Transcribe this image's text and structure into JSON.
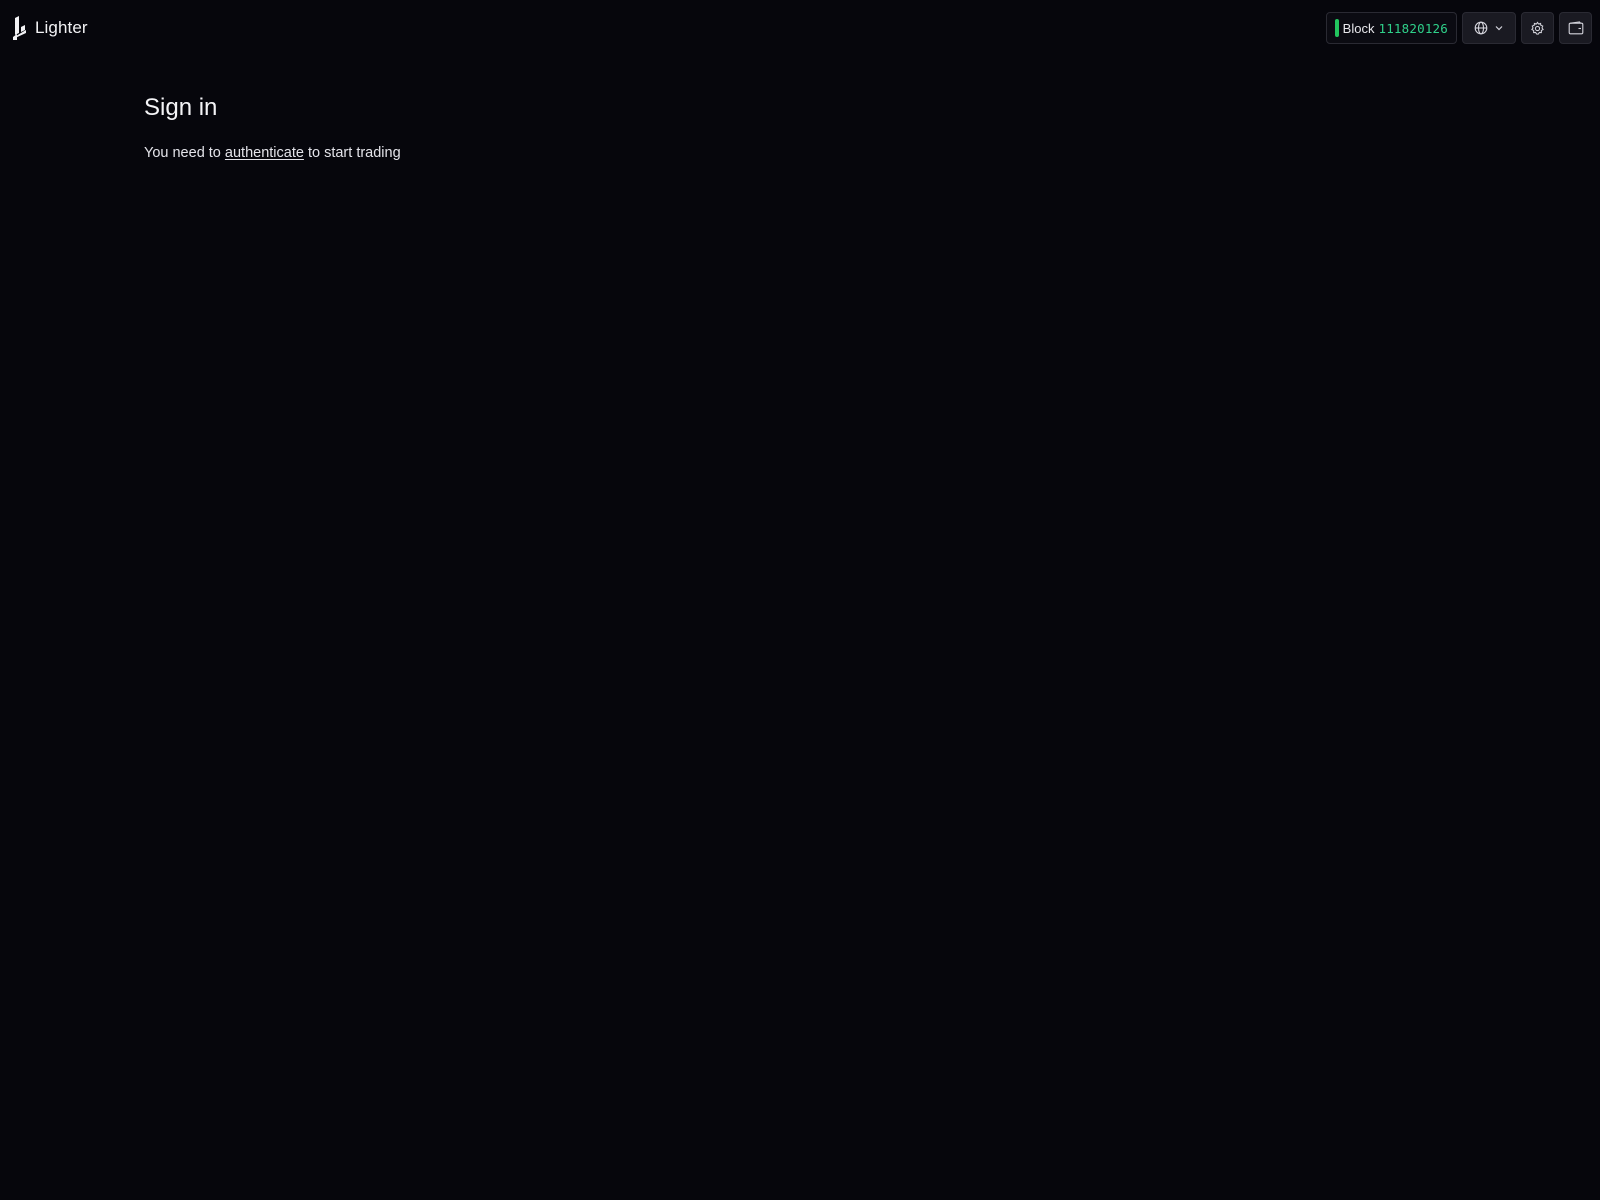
{
  "header": {
    "brand": {
      "name": "Lighter",
      "icon": "lighter-logo-icon"
    },
    "block": {
      "label": "Block",
      "number": "111820126",
      "status_color": "#22c55e",
      "number_color": "#2fd08a"
    },
    "language_button": {
      "icon": "globe-icon",
      "caret": "chevron-down-icon"
    },
    "settings_button": {
      "icon": "gear-icon"
    },
    "wallet_button": {
      "icon": "wallet-icon"
    }
  },
  "main": {
    "title": "Sign in",
    "message": {
      "prefix": "You need to",
      "link": "authenticate",
      "suffix": "to start trading"
    }
  },
  "colors": {
    "background": "#06060c",
    "text": "#ececf1"
  }
}
